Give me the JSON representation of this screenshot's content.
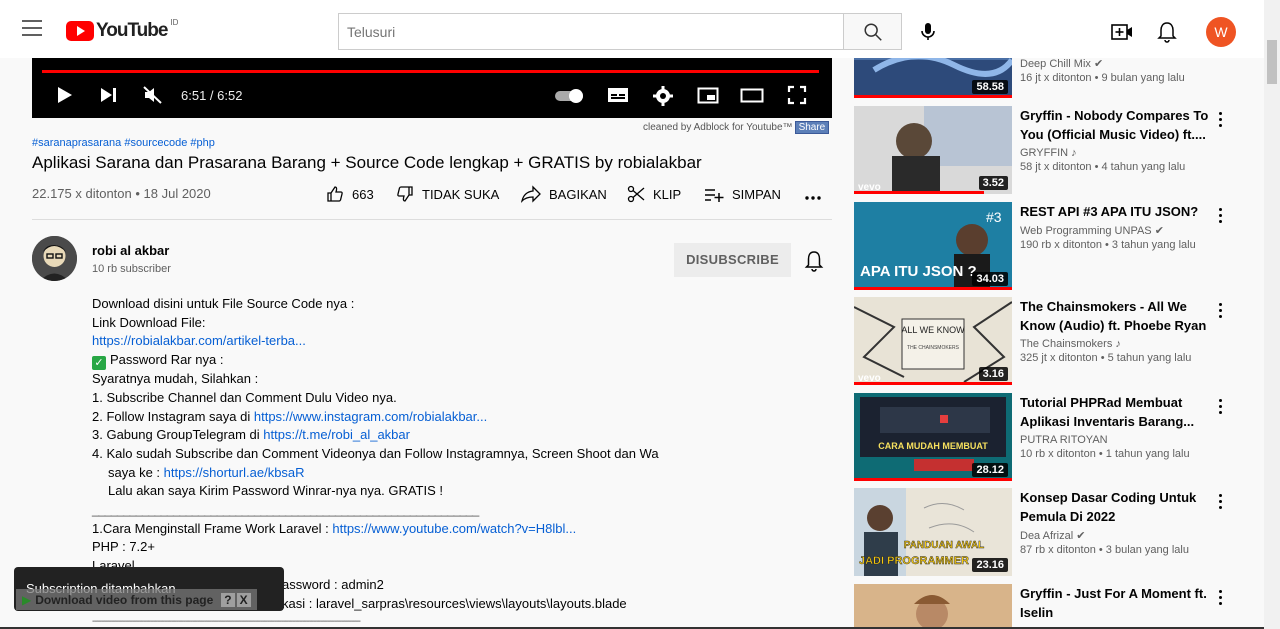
{
  "header": {
    "logo_text": "YouTube",
    "country_code": "ID",
    "search_placeholder": "Telusuri",
    "avatar_letter": "W",
    "avatar_color": "#ef5423"
  },
  "player": {
    "time": "6:51 / 6:52",
    "progress": 0.998
  },
  "adblock": {
    "text": "cleaned by Adblock for Youtube™",
    "share": "Share"
  },
  "video": {
    "hashtags": "#saranaprasarana #sourcecode #php",
    "title": "Aplikasi Sarana dan Prasarana Barang + Source Code lengkap + GRATIS by robialakbar",
    "views": "22.175 x ditonton • 18 Jul 2020",
    "likes": "663",
    "dislike": "TIDAK SUKA",
    "share": "BAGIKAN",
    "clip": "KLIP",
    "save": "SIMPAN"
  },
  "channel": {
    "name": "robi al akbar",
    "subs": "10 rb subscriber",
    "unsubscribe": "DISUBSCRIBE"
  },
  "description": {
    "l1": "Download disini untuk File Source Code nya :",
    "l2": "Link Download File:",
    "l3": "https://robialakbar.com/artikel-terba...",
    "l4": "Password Rar nya :",
    "l5": "Syaratnya mudah, Silahkan  :",
    "l6": "1. Subscribe Channel dan Comment Dulu Video nya.",
    "l7a": "2. Follow Instagram saya  di ",
    "l7b": "https://www.instagram.com/robialakbar...",
    "l8a": "3. Gabung GroupTelegram di ",
    "l8b": "https://t.me/robi_al_akbar",
    "l9": "4. Kalo sudah Subscribe dan Comment Videonya dan Follow Instagramnya, Screen Shoot dan Wa",
    "l10a": "saya ke : ",
    "l10b": "https://shorturl.ae/kbsaR",
    "l11": "Lalu akan saya Kirim Password Winrar-nya nya. GRATIS !",
    "l12": "______________________________________________________________",
    "l13a": "1.Cara Menginstall Frame Work Laravel : ",
    "l13b": "https://www.youtube.com/watch?v=H8lbl...",
    "l14": "PHP : 7.2+",
    "l15": "Laravel",
    "l16": "assword : admin2",
    "l17": "kasi : laravel_sarpras\\resources\\views\\layouts\\layouts.blade",
    "l18": "-------------------------------------------------------------------------------------------------------------------"
  },
  "toast": {
    "message": "Subscription ditambahkan",
    "download": "Download video from this page",
    "help": "?",
    "close": "X"
  },
  "recommendations": [
    {
      "title": "",
      "channel": "Deep Chill Mix",
      "meta": "16 jt x ditonton • 9 bulan yang lalu",
      "duration": "58.58",
      "verified": true
    },
    {
      "title": "Gryffin - Nobody Compares To You (Official Music Video) ft....",
      "channel": "GRYFFIN",
      "meta": "58 jt x ditonton • 4 tahun yang lalu",
      "duration": "3.52",
      "thumb_text": "vevo"
    },
    {
      "title": "REST API #3 APA ITU JSON?",
      "channel": "Web Programming UNPAS",
      "meta": "190 rb x ditonton • 3 tahun yang lalu",
      "duration": "34.03",
      "thumb_text": "APA ITU JSON ?",
      "thumb_num": "#3"
    },
    {
      "title": "The Chainsmokers - All We Know (Audio) ft. Phoebe Ryan",
      "channel": "The Chainsmokers",
      "meta": "325 jt x ditonton • 5 tahun yang lalu",
      "duration": "3.16",
      "thumb_text": "ALL WE KNOW",
      "thumb_sub": "THE CHAINSMOKERS"
    },
    {
      "title": "Tutorial PHPRad Membuat Aplikasi Inventaris Barang...",
      "channel": "PUTRA RITOYAN",
      "meta": "10 rb x ditonton • 1 tahun yang lalu",
      "duration": "28.12",
      "thumb_text": "CARA MUDAH MEMBUAT"
    },
    {
      "title": "Konsep Dasar Coding Untuk Pemula Di 2022",
      "channel": "Dea Afrizal",
      "meta": "87 rb x ditonton • 3 bulan yang lalu",
      "duration": "23.16",
      "thumb_text": "PANDUAN AWAL",
      "thumb_text2": "JADI PROGRAMMER"
    },
    {
      "title": "Gryffin - Just For A Moment ft. Iselin",
      "channel": "",
      "meta": "",
      "duration": ""
    }
  ]
}
